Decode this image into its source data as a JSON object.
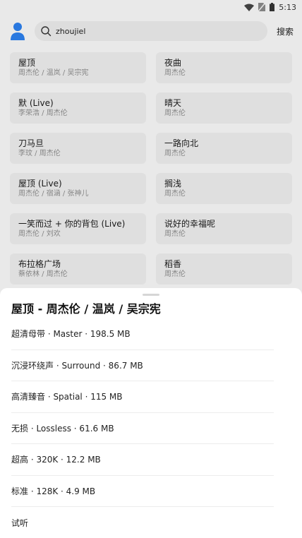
{
  "status_bar": {
    "time": "5:13",
    "icons": [
      "wifi-icon",
      "no-sim-icon",
      "battery-icon"
    ]
  },
  "header": {
    "search_value": "zhoujiel",
    "search_button": "搜索"
  },
  "results": [
    {
      "title": "屋顶",
      "artists": "周杰伦 / 温岚 / 吴宗宪"
    },
    {
      "title": "夜曲",
      "artists": "周杰伦"
    },
    {
      "title": "默 (Live)",
      "artists": "李荣浩 / 周杰伦"
    },
    {
      "title": "晴天",
      "artists": "周杰伦"
    },
    {
      "title": "刀马旦",
      "artists": "李玟 / 周杰伦"
    },
    {
      "title": "一路向北",
      "artists": "周杰伦"
    },
    {
      "title": "屋顶 (Live)",
      "artists": "周杰伦 / 宿涵 / 张神儿"
    },
    {
      "title": "搁浅",
      "artists": "周杰伦"
    },
    {
      "title": "一笑而过 + 你的背包 (Live)",
      "artists": "周杰伦 / 刘欢"
    },
    {
      "title": "说好的幸福呢",
      "artists": "周杰伦"
    },
    {
      "title": "布拉格广场",
      "artists": "蔡依林 / 周杰伦"
    },
    {
      "title": "稻香",
      "artists": "周杰伦"
    }
  ],
  "sheet": {
    "title": "屋顶 - 周杰伦 / 温岚 / 吴宗宪",
    "options": [
      "超清母带 · Master · 198.5 MB",
      "沉浸环绕声 · Surround · 86.7 MB",
      "高清臻音 · Spatial · 115 MB",
      "无损 · Lossless · 61.6 MB",
      "超高 · 320K · 12.2 MB",
      "标准 · 128K · 4.9 MB",
      "试听"
    ]
  },
  "colors": {
    "accent": "#2b7de9",
    "card_bg": "#e9e9e9",
    "sheet_bg": "#ffffff"
  }
}
